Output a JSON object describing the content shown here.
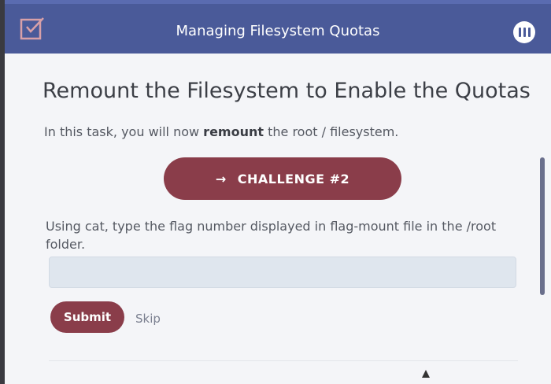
{
  "header": {
    "title": "Managing Filesystem Quotas",
    "logo_icon": "checkbox-edit-icon",
    "menu_icon": "menu-icon"
  },
  "task": {
    "heading": "Remount the Filesystem to Enable the Quotas",
    "intro_prefix": "In this task, you will now ",
    "intro_bold": "remount",
    "intro_suffix": " the root / filesystem."
  },
  "challenge": {
    "arrow": "→",
    "label": "CHALLENGE #2"
  },
  "question": {
    "text": "Using cat, type the flag number displayed in flag-mount file in the /root folder."
  },
  "answer": {
    "value": "",
    "placeholder": ""
  },
  "actions": {
    "submit_label": "Submit",
    "skip_label": "Skip"
  },
  "colors": {
    "header": "#4a5a99",
    "accent": "#8a3d4a",
    "input_bg": "#dfe6ee"
  }
}
